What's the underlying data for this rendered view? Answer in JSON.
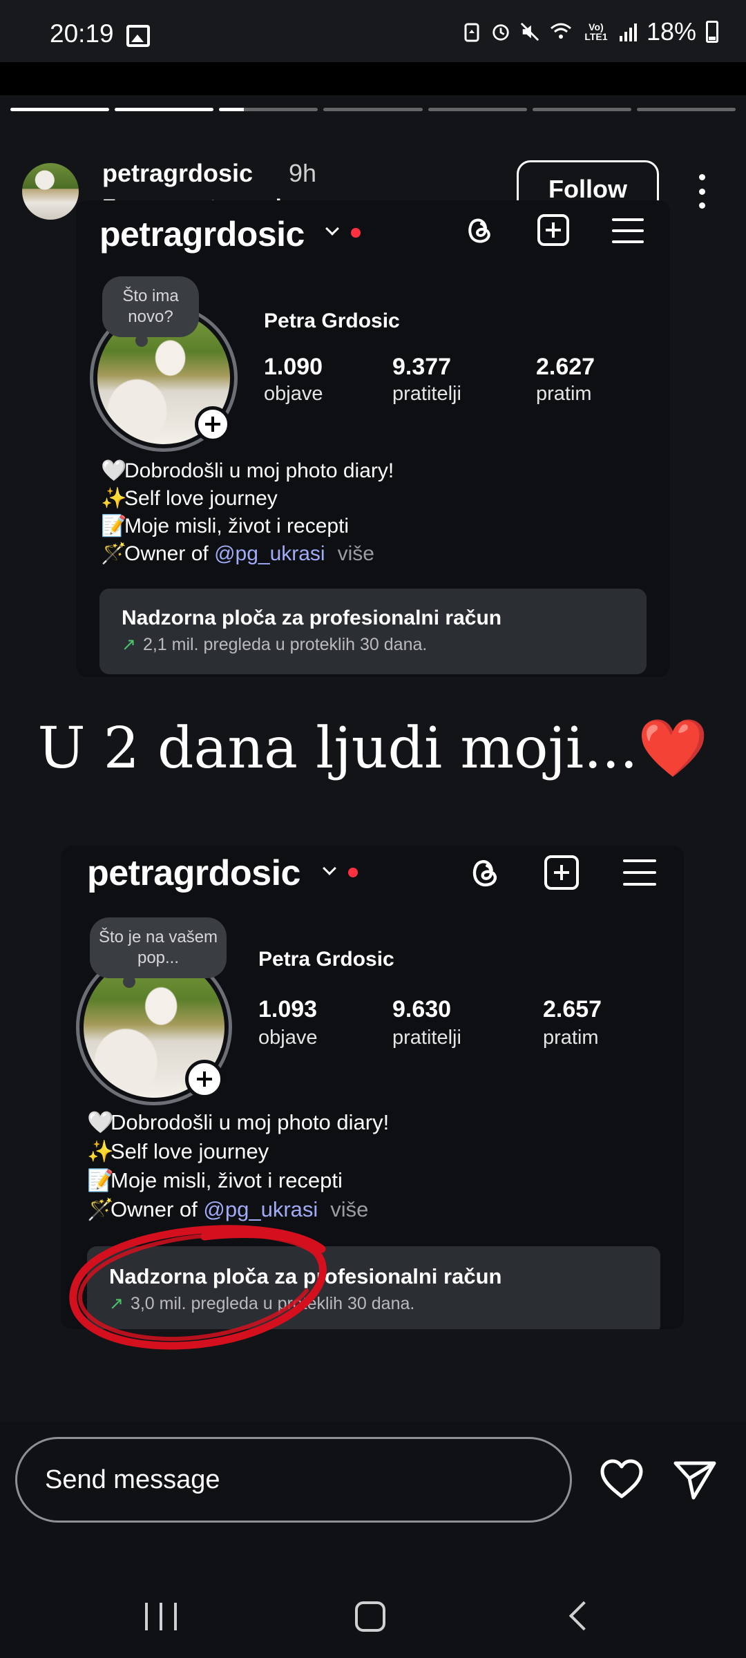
{
  "status_bar": {
    "time": "20:19",
    "battery": "18%",
    "lte_label": "Vo) LTE1",
    "icons": [
      "image-icon",
      "recycle-icon",
      "alarm-icon",
      "mute-icon",
      "wifi-icon",
      "signal-icon",
      "battery-icon"
    ]
  },
  "story": {
    "progress": [
      1,
      1,
      0.25,
      0,
      0,
      0,
      0
    ],
    "username": "petragrdosic",
    "time_ago": "9h",
    "subtitle": "From create mode",
    "follow_label": "Follow",
    "caption": "U 2 dana ljudi moji...",
    "caption_emoji": "❤️"
  },
  "profile_before": {
    "username": "petragrdosic",
    "note": "Što ima novo?",
    "display_name": "Petra Grdosic",
    "stats": [
      {
        "value": "1.090",
        "label": "objave"
      },
      {
        "value": "9.377",
        "label": "pratitelji"
      },
      {
        "value": "2.627",
        "label": "pratim"
      }
    ],
    "bio": [
      {
        "emoji": "🤍",
        "text": "Dobrodošli u moj photo diary!"
      },
      {
        "emoji": "✨",
        "text": "Self love journey"
      },
      {
        "emoji": "📝",
        "text": "Moje misli, život i recepti"
      }
    ],
    "bio_last_emoji": "🪄",
    "bio_last_prefix": "Owner of ",
    "bio_mention": "@pg_ukrasi",
    "bio_more": "više",
    "dashboard_title": "Nadzorna ploča za profesionalni račun",
    "dashboard_sub": "2,1 mil. pregleda u proteklih 30 dana."
  },
  "profile_after": {
    "username": "petragrdosic",
    "note": "Što je na vašem pop...",
    "display_name": "Petra Grdosic",
    "stats": [
      {
        "value": "1.093",
        "label": "objave"
      },
      {
        "value": "9.630",
        "label": "pratitelji"
      },
      {
        "value": "2.657",
        "label": "pratim"
      }
    ],
    "bio": [
      {
        "emoji": "🤍",
        "text": "Dobrodošli u moj photo diary!"
      },
      {
        "emoji": "✨",
        "text": "Self love journey"
      },
      {
        "emoji": "📝",
        "text": "Moje misli, život i recepti"
      }
    ],
    "bio_last_emoji": "🪄",
    "bio_last_prefix": "Owner of ",
    "bio_mention": "@pg_ukrasi",
    "bio_more": "više",
    "dashboard_title": "Nadzorna ploča za profesionalni račun",
    "dashboard_sub": "3,0 mil. pregleda u proteklih 30 dana."
  },
  "message_bar": {
    "placeholder": "Send message"
  },
  "colors": {
    "accent_red": "#ff3040",
    "mention": "#a2abf7",
    "trend_green": "#4cc36b",
    "annotation_red": "#d4101f"
  }
}
